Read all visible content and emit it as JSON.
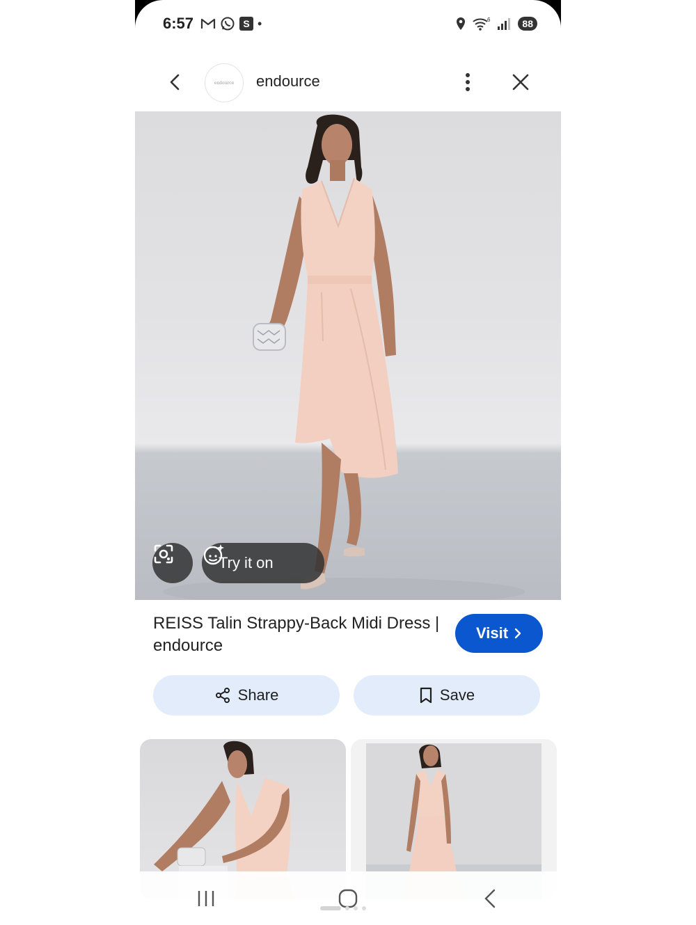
{
  "status_bar": {
    "time": "6:57",
    "battery": "88",
    "icons": [
      "gmail-icon",
      "whatsapp-icon",
      "s-app-icon",
      "notification-dot",
      "location-icon",
      "wifi-icon",
      "signal-icon",
      "battery-icon"
    ],
    "s_badge": "S",
    "dot": "•",
    "wifi_sup": "6"
  },
  "header": {
    "source_name": "endource",
    "logo_text": "endource"
  },
  "image_actions": {
    "try_on_label": "Try it on"
  },
  "result": {
    "title": "REISS Talin Strappy-Back Midi Dress | endource",
    "visit_label": "Visit"
  },
  "actions": {
    "share_label": "Share",
    "save_label": "Save"
  },
  "colors": {
    "visit_button": "#0b57d0",
    "action_button_bg": "#e3ecfb",
    "dress": "#f3d2c4"
  }
}
